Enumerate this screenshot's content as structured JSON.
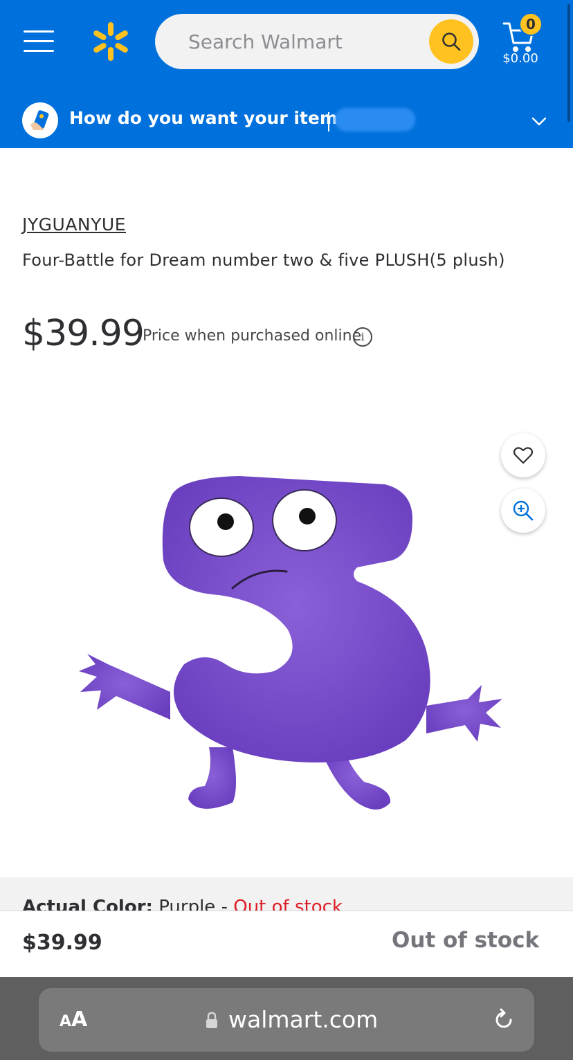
{
  "header": {
    "search_placeholder": "Search Walmart",
    "cart_count": "0",
    "cart_total": "$0.00",
    "delivery_prompt": "How do you want your items?",
    "brand_colors": {
      "blue": "#0071dc",
      "yellow": "#ffc220"
    }
  },
  "product": {
    "brand": "JYGUANYUE",
    "title": "Four-Battle for Dream number two & five PLUSH(5 plush)",
    "price": "$39.99",
    "price_note": "Price when purchased online",
    "info_icon_glyph": "i",
    "image_alt": "purple-plush-toy"
  },
  "variant": {
    "label": "Actual Color:",
    "value": "Purple",
    "separator": "-",
    "status": "Out of stock",
    "status_color": "#de1c24"
  },
  "sticky_bar": {
    "price": "$39.99",
    "status": "Out of stock"
  },
  "browser": {
    "aa_small": "A",
    "aa_large": "A",
    "domain": "walmart.com"
  },
  "icons": [
    "menu-icon",
    "walmart-spark-icon",
    "search-icon",
    "cart-icon",
    "delivery-icon",
    "chevron-down-icon",
    "heart-icon",
    "zoom-in-icon",
    "info-icon",
    "lock-icon",
    "reload-icon"
  ]
}
